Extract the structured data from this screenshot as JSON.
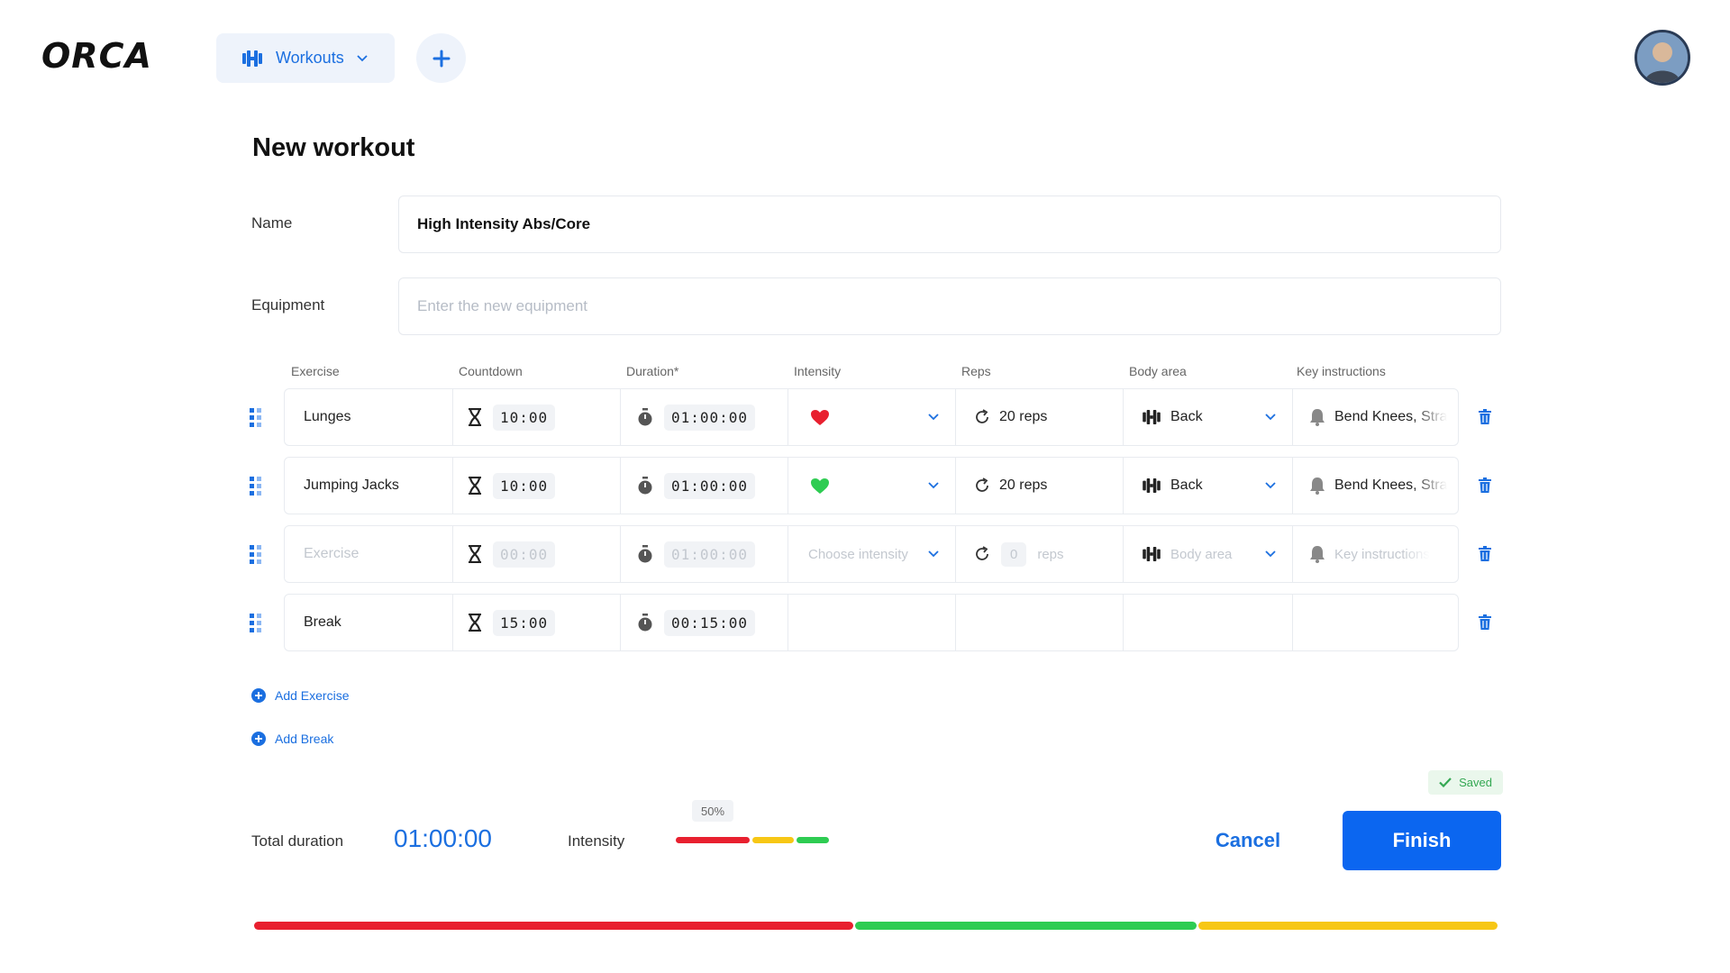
{
  "app": {
    "logo": "ORCA"
  },
  "header": {
    "workouts_label": "Workouts"
  },
  "page": {
    "title": "New workout"
  },
  "form": {
    "name_label": "Name",
    "name_value": "High Intensity Abs/Core",
    "equipment_label": "Equipment",
    "equipment_placeholder": "Enter the new equipment"
  },
  "table": {
    "headers": [
      "Exercise",
      "Countdown",
      "Duration*",
      "Intensity",
      "Reps",
      "Body area",
      "Key instructions"
    ],
    "rows": [
      {
        "exercise": "Lunges",
        "countdown": "10:00",
        "duration": "01:00:00",
        "intensity_color": "#e8202f",
        "reps": "20 reps",
        "body_area": "Back",
        "instructions": "Bend Knees, Stra"
      },
      {
        "exercise": "Jumping Jacks",
        "countdown": "10:00",
        "duration": "01:00:00",
        "intensity_color": "#2ecc52",
        "reps": "20 reps",
        "body_area": "Back",
        "instructions": "Bend Knees, Stra"
      },
      {
        "exercise_placeholder": "Exercise",
        "countdown": "00:00",
        "duration": "01:00:00",
        "intensity_placeholder": "Choose intensity",
        "reps_value": "0",
        "reps_unit": "reps",
        "body_area_placeholder": "Body area",
        "instructions_placeholder": "Key instructions"
      },
      {
        "exercise": "Break",
        "countdown": "15:00",
        "duration": "00:15:00"
      }
    ]
  },
  "actions": {
    "add_exercise": "Add Exercise",
    "add_break": "Add Break"
  },
  "footer": {
    "saved": "Saved",
    "total_label": "Total duration",
    "total_value": "01:00:00",
    "intensity_label": "Intensity",
    "intensity_pct": "50%",
    "cancel": "Cancel",
    "finish": "Finish"
  },
  "colors": {
    "accent": "#1b6fe0",
    "red": "#e8202f",
    "green": "#2ecc52",
    "yellow": "#f7c715"
  },
  "intensity_mix": [
    {
      "color": "#e8202f",
      "fraction": 0.5
    },
    {
      "color": "#f7c715",
      "fraction": 0.28
    },
    {
      "color": "#2ecc52",
      "fraction": 0.22
    }
  ],
  "timeline": [
    {
      "color": "#e8202f",
      "fraction": 0.483
    },
    {
      "color": "#2ecc52",
      "fraction": 0.276
    },
    {
      "color": "#f7c715",
      "fraction": 0.241
    }
  ]
}
